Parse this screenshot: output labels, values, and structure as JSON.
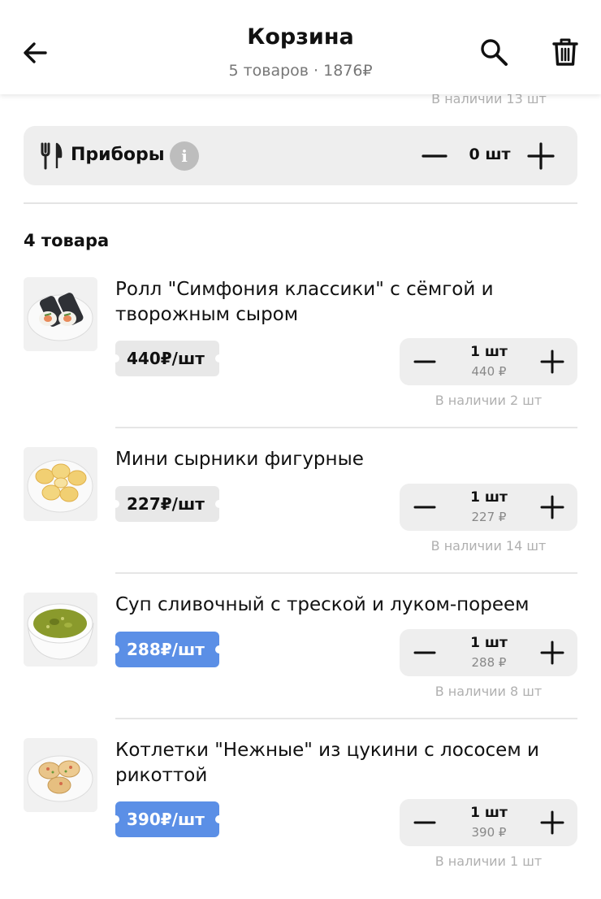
{
  "header": {
    "title": "Корзина",
    "subtitle": "5 товаров · 1876₽"
  },
  "icons": {
    "back": "arrow-left-icon",
    "search": "search-icon",
    "trash": "trash-icon",
    "cutlery": "fork-knife-icon",
    "info": "info-icon",
    "minus": "minus-icon",
    "plus": "plus-icon"
  },
  "colors": {
    "promo_price": "#5b8fe6",
    "regular_price_bg": "#e8e8e8",
    "panel_bg": "#eeeeee"
  },
  "previous_item_stock": "В наличии 13 шт",
  "cutlery": {
    "label": "Приборы",
    "info_symbol": "i",
    "quantity": "0 шт"
  },
  "section_title": "4 товара",
  "items": [
    {
      "name": "Ролл \"Симфония классики\" с сёмгой и творожным сыром",
      "price": "440₽/шт",
      "promo": false,
      "quantity": "1 шт",
      "sum": "440 ₽",
      "stock": "В наличии 2 шт"
    },
    {
      "name": "Мини сырники фигурные",
      "price": "227₽/шт",
      "promo": false,
      "quantity": "1 шт",
      "sum": "227 ₽",
      "stock": "В наличии 14 шт"
    },
    {
      "name": "Суп сливочный с треской и луком-пореем",
      "price": "288₽/шт",
      "promo": true,
      "quantity": "1 шт",
      "sum": "288 ₽",
      "stock": "В наличии 8 шт"
    },
    {
      "name": "Котлетки \"Нежные\" из цукини с лососем и рикоттой",
      "price": "390₽/шт",
      "promo": true,
      "quantity": "1 шт",
      "sum": "390 ₽",
      "stock": "В наличии 1 шт"
    }
  ]
}
